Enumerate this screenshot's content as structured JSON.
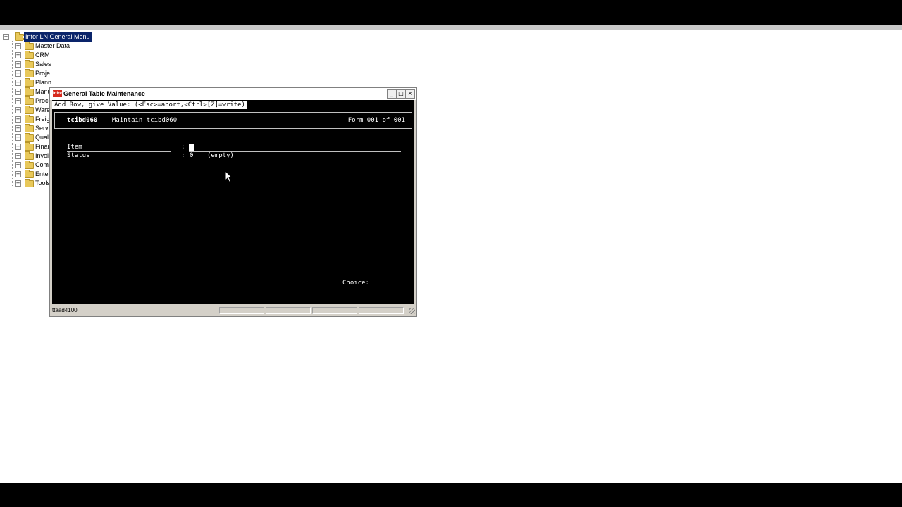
{
  "tree": {
    "root_label": "Infor LN General Menu",
    "items": [
      {
        "label": "Master Data"
      },
      {
        "label": "CRM"
      },
      {
        "label": "Sales"
      },
      {
        "label": "Proje"
      },
      {
        "label": "Plann"
      },
      {
        "label": "Manu"
      },
      {
        "label": "Proc"
      },
      {
        "label": "Ware"
      },
      {
        "label": "Freig"
      },
      {
        "label": "Servi"
      },
      {
        "label": "Quali"
      },
      {
        "label": "Finan"
      },
      {
        "label": "Invoi"
      },
      {
        "label": "Comm"
      },
      {
        "label": "Enter"
      },
      {
        "label": "Tools"
      }
    ]
  },
  "window": {
    "title": "General Table Maintenance",
    "app_icon_text": "infor",
    "minimize": "0",
    "maximize": "1",
    "close": "r",
    "statusbar_text": "ttaad4100"
  },
  "terminal": {
    "prompt": "Add Row, give Value: (<Esc>=abort,<Ctrl>[Z]=write)",
    "session_code": "tcibd060",
    "session_title": "Maintain tcibd060",
    "form_counter": "Form 001 of 001",
    "fields": [
      {
        "label": "Item",
        "colon": ":",
        "value": ""
      },
      {
        "label": "Status",
        "colon": ":",
        "value": "0",
        "description": "(empty)"
      }
    ],
    "choice_label": "Choice:"
  },
  "colors": {
    "terminal_bg": "#000000",
    "selection": "#0a246a",
    "brand_icon": "#d62b1e"
  }
}
